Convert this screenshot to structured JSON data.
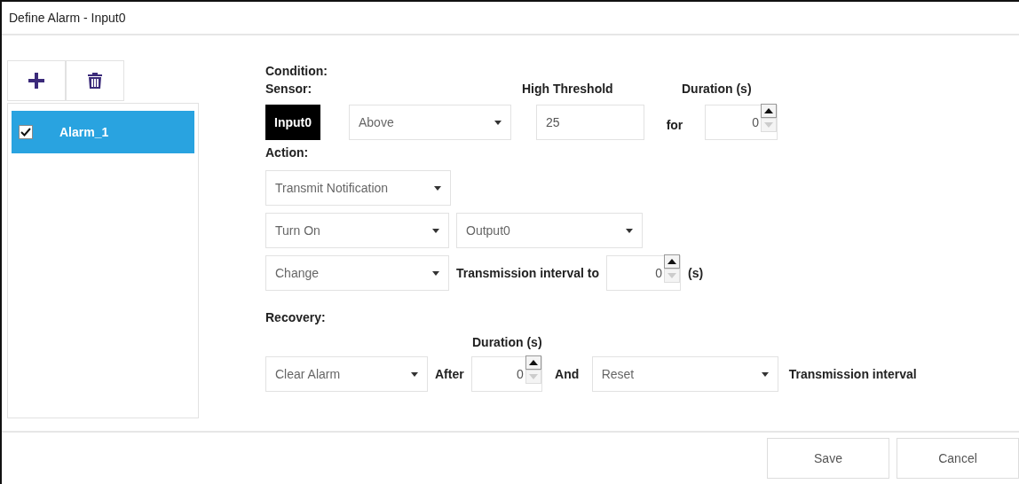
{
  "window": {
    "title": "Define Alarm - Input0"
  },
  "alarms": [
    {
      "label": "Alarm_1",
      "checked": true,
      "selected": true
    }
  ],
  "condition": {
    "heading": "Condition:",
    "sensor_label": "Sensor:",
    "threshold_label": "High Threshold",
    "duration_label": "Duration (s)",
    "sensor": "Input0",
    "comparison": "Above",
    "threshold": "25",
    "for_label": "for",
    "duration": "0"
  },
  "action": {
    "heading": "Action:",
    "notification": "Transmit Notification",
    "switch": "Turn On",
    "output": "Output0",
    "interval_mode": "Change",
    "interval_label": "Transmission interval",
    "to_label": "to",
    "interval": "0",
    "unit": "(s)"
  },
  "recovery": {
    "heading": "Recovery:",
    "duration_label": "Duration (s)",
    "clear": "Clear Alarm",
    "after_label": "After",
    "duration": "0",
    "and_label": "And",
    "reset": "Reset",
    "interval_label": "Transmission interval"
  },
  "buttons": [
    "Save",
    "Cancel"
  ]
}
